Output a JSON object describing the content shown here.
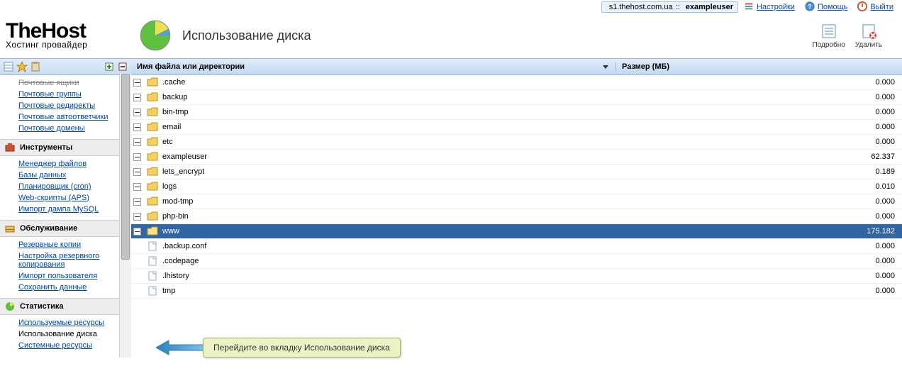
{
  "top": {
    "server": "s1.thehost.com.ua",
    "user": "exampleuser",
    "settings": "Настройки",
    "help": "Помощь",
    "logout": "Выйти"
  },
  "logo": {
    "main": "TheHost",
    "sub": "Хостинг провайдер"
  },
  "page_title": "Использование диска",
  "header_actions": {
    "detail": "Подробно",
    "delete": "Удалить"
  },
  "sidebar": {
    "top_items": [
      "Почтовые ящики",
      "Почтовые группы",
      "Почтовые редиректы",
      "Почтовые автоответчики",
      "Почтовые домены"
    ],
    "groups": [
      {
        "title": "Инструменты",
        "items": [
          "Менеджер файлов",
          "Базы данных",
          "Планировщик (cron)",
          "Web-скрипты (APS)",
          "Импорт дампа MySQL"
        ]
      },
      {
        "title": "Обслуживание",
        "items": [
          "Резервные копии",
          "Настройка резервного копирования",
          "Импорт пользователя",
          "Сохранить данные"
        ]
      },
      {
        "title": "Статистика",
        "items": [
          "Используемые ресурсы",
          "Использование диска",
          "Системные ресурсы"
        ]
      }
    ]
  },
  "grid": {
    "col_name": "Имя файла или директории",
    "col_size": "Размер (МБ)",
    "rows": [
      {
        "type": "folder",
        "name": ".cache",
        "size": "0.000"
      },
      {
        "type": "folder",
        "name": "backup",
        "size": "0.000"
      },
      {
        "type": "folder",
        "name": "bin-tmp",
        "size": "0.000"
      },
      {
        "type": "folder",
        "name": "email",
        "size": "0.000"
      },
      {
        "type": "folder",
        "name": "etc",
        "size": "0.000"
      },
      {
        "type": "folder",
        "name": "exampleuser",
        "size": "62.337"
      },
      {
        "type": "folder",
        "name": "lets_encrypt",
        "size": "0.189"
      },
      {
        "type": "folder",
        "name": "logs",
        "size": "0.010"
      },
      {
        "type": "folder",
        "name": "mod-tmp",
        "size": "0.000"
      },
      {
        "type": "folder",
        "name": "php-bin",
        "size": "0.000"
      },
      {
        "type": "folder",
        "name": "www",
        "size": "175.182",
        "selected": true
      },
      {
        "type": "file",
        "name": ".backup.conf",
        "size": "0.000"
      },
      {
        "type": "file",
        "name": ".codepage",
        "size": "0.000"
      },
      {
        "type": "file",
        "name": ".lhistory",
        "size": "0.000"
      },
      {
        "type": "file",
        "name": "tmp",
        "size": "0.000"
      }
    ]
  },
  "callout": "Перейдите во вкладку Использование диска"
}
